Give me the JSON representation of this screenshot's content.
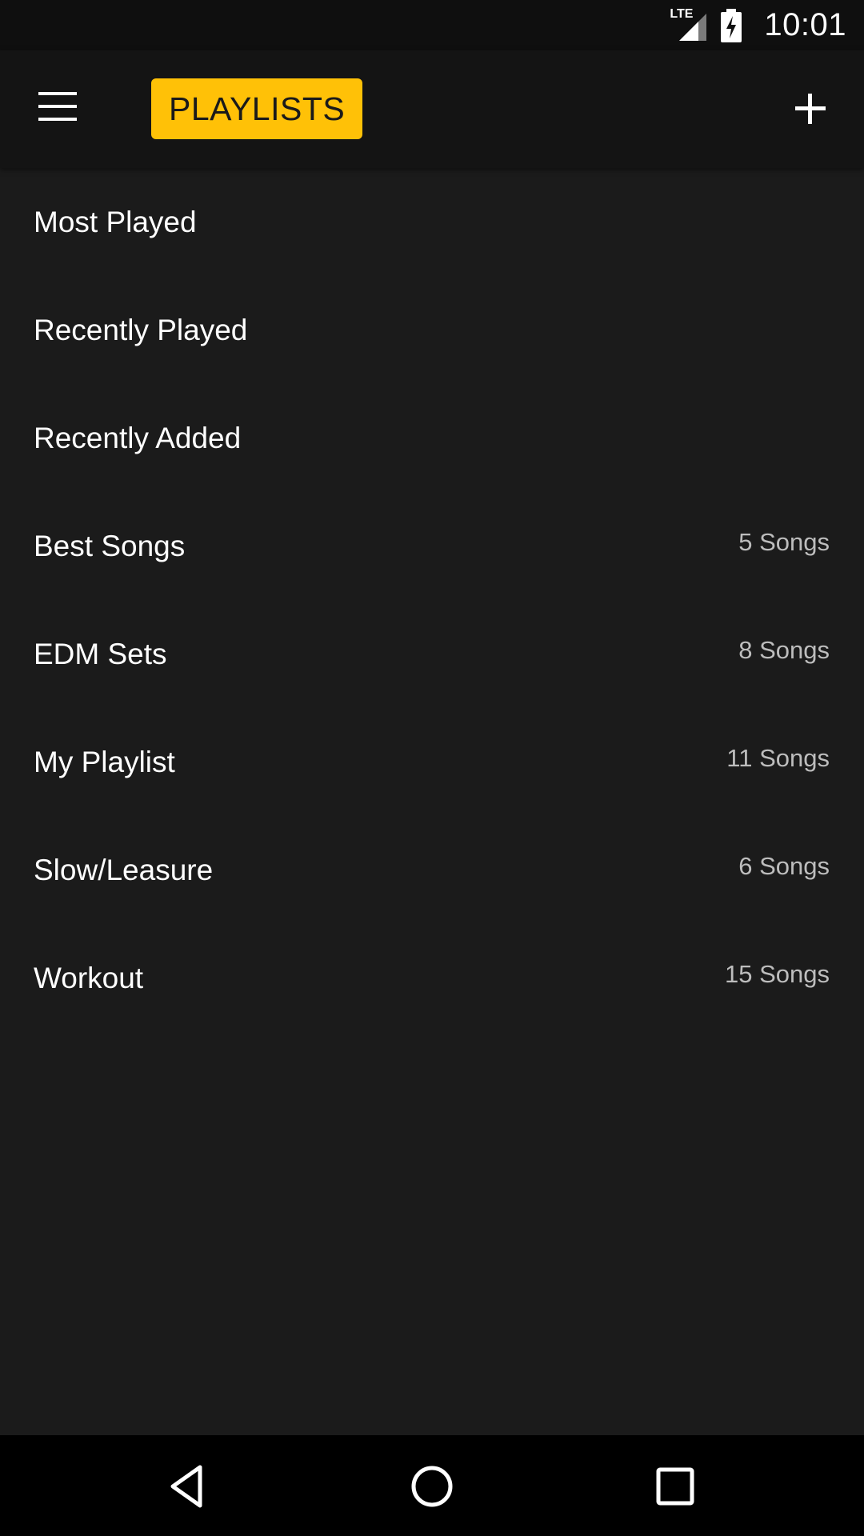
{
  "status_bar": {
    "network_label": "LTE",
    "time": "10:01",
    "icons": [
      "lte-signal-icon",
      "battery-charging-icon"
    ]
  },
  "app_bar": {
    "title": "PLAYLISTS",
    "icons": [
      "menu-icon",
      "add-icon"
    ],
    "accent_color": "#ffc107"
  },
  "playlists": [
    {
      "name": "Most Played",
      "count": ""
    },
    {
      "name": "Recently Played",
      "count": ""
    },
    {
      "name": "Recently Added",
      "count": ""
    },
    {
      "name": "Best Songs",
      "count": "5 Songs"
    },
    {
      "name": "EDM Sets",
      "count": "8 Songs"
    },
    {
      "name": "My Playlist",
      "count": "11 Songs"
    },
    {
      "name": "Slow/Leasure",
      "count": "6 Songs"
    },
    {
      "name": "Workout",
      "count": "15 Songs"
    }
  ],
  "nav_bar": {
    "icons": [
      "back-icon",
      "home-icon",
      "recents-icon"
    ]
  },
  "colors": {
    "background": "#1b1b1b",
    "app_bar": "#141414",
    "status_bar": "#0f0f0f",
    "nav_bar": "#000000",
    "secondary_text": "#bdbdbd"
  }
}
